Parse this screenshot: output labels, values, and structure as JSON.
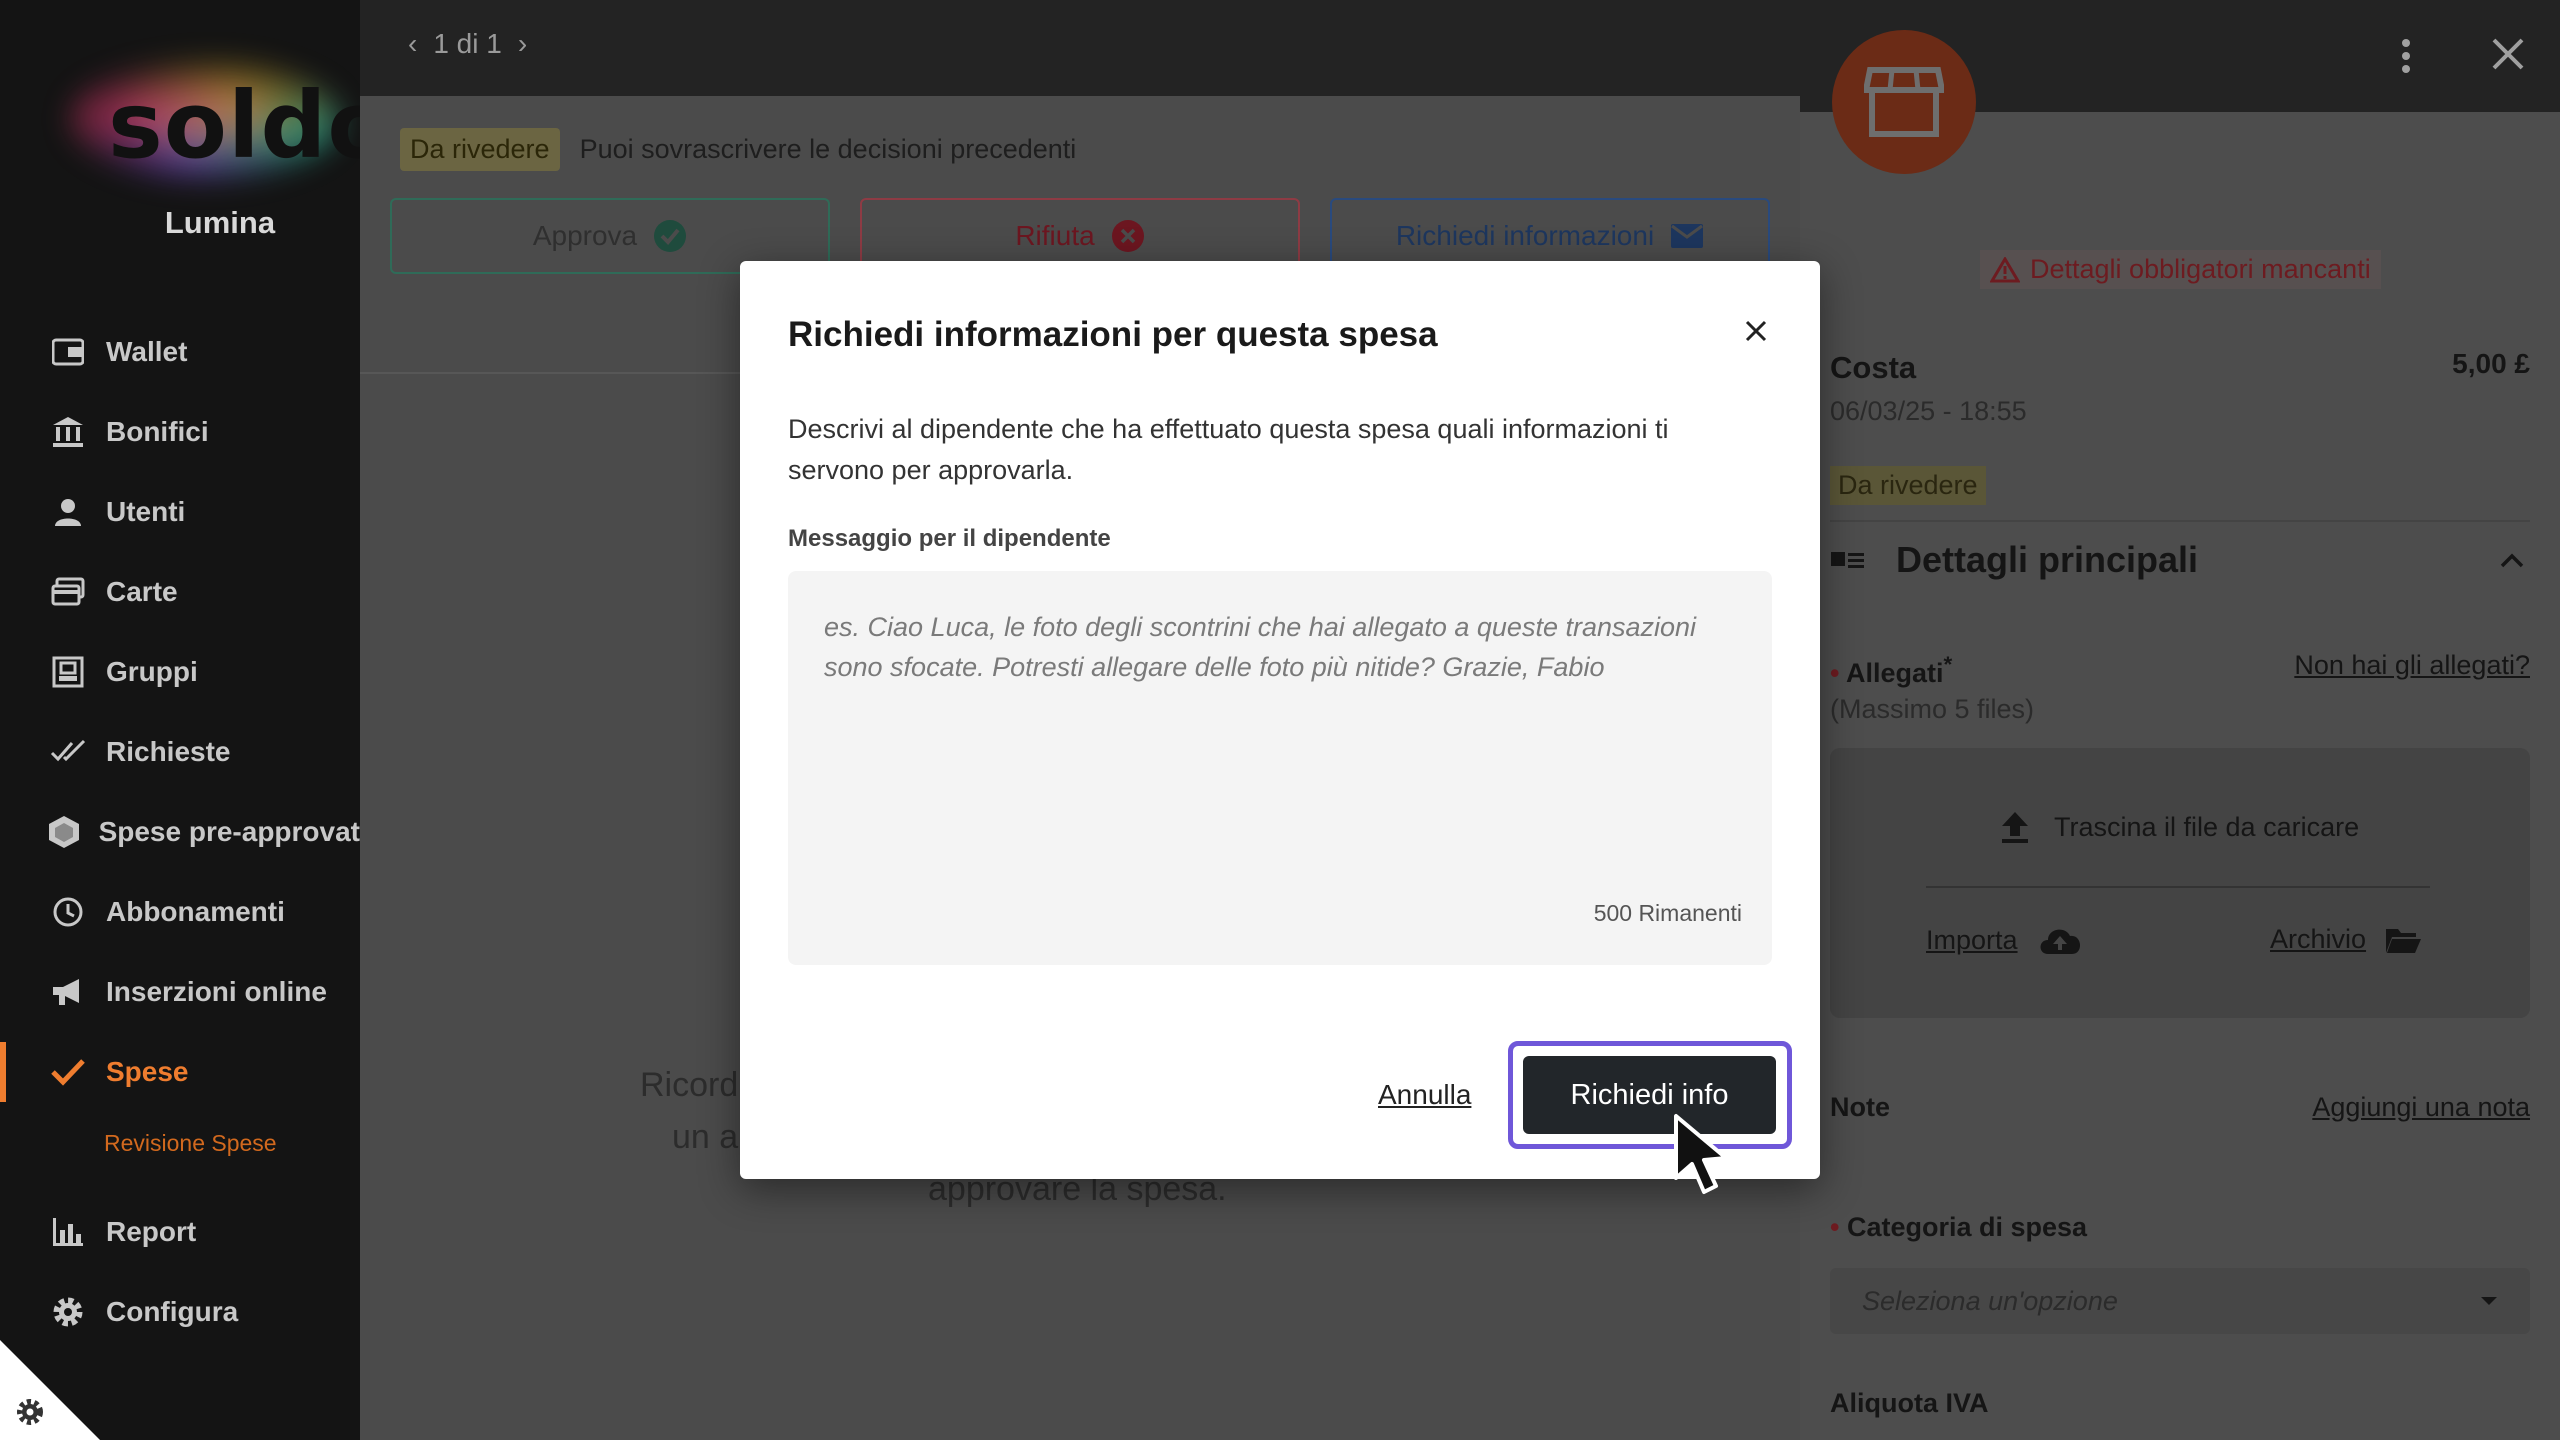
{
  "brand": {
    "logo_text": "soldo",
    "org_name": "Lumina"
  },
  "sidebar": {
    "items": [
      {
        "label": "Wallet",
        "icon": "wallet-icon"
      },
      {
        "label": "Bonifici",
        "icon": "bank-icon"
      },
      {
        "label": "Utenti",
        "icon": "user-icon"
      },
      {
        "label": "Carte",
        "icon": "cards-icon"
      },
      {
        "label": "Gruppi",
        "icon": "groups-icon"
      },
      {
        "label": "Richieste",
        "icon": "double-check-icon"
      },
      {
        "label": "Spese pre-approvat",
        "icon": "hexagon-icon"
      },
      {
        "label": "Abbonamenti",
        "icon": "clock-icon"
      },
      {
        "label": "Inserzioni online",
        "icon": "megaphone-icon"
      },
      {
        "label": "Spese",
        "icon": "check-icon",
        "active": true
      },
      {
        "label": "Report",
        "icon": "bar-chart-icon"
      },
      {
        "label": "Configura",
        "icon": "gear-icon"
      }
    ],
    "sub_item": "Revisione Spese"
  },
  "main": {
    "pager": "1 di 1",
    "status_tag": "Da rivedere",
    "notice": "Puoi sovrascrivere le decisioni precedenti",
    "actions": {
      "approve": "Approva",
      "reject": "Rifiuta",
      "request_info": "Richiedi informazioni"
    },
    "bg_text_line1_start": "Ricord",
    "bg_text_line2_start": "un a",
    "bg_text_line3": "approvare la spesa."
  },
  "panel": {
    "missing_details": "Dettagli obbligatori mancanti",
    "merchant": "Costa",
    "amount": "5,00 £",
    "datetime": "06/03/25 - 18:55",
    "status_tag": "Da rivedere",
    "section_title": "Dettagli principali",
    "attachments_label": "Allegati",
    "attachments_required_mark": "*",
    "attachments_hint": "(Massimo 5 files)",
    "no_attachments_link": "Non hai gli allegati?",
    "drag_text": "Trascina il file da caricare",
    "import_label": "Importa",
    "archive_label": "Archivio",
    "notes_label": "Note",
    "add_note_link": "Aggiungi una nota",
    "category_label": "Categoria di spesa",
    "category_placeholder": "Seleziona un'opzione",
    "vat_label": "Aliquota IVA"
  },
  "modal": {
    "title": "Richiedi informazioni per questa spesa",
    "description": "Descrivi al dipendente che ha effettuato questa spesa quali informazioni ti servono per approvarla.",
    "field_label": "Messaggio per il dipendente",
    "placeholder": "es. Ciao Luca, le foto degli scontrini che hai allegato a queste transazioni sono sfocate. Potresti allegare delle foto più nitide? Grazie, Fabio",
    "value": "",
    "counter": "500 Rimanenti",
    "cancel_label": "Annulla",
    "submit_label": "Richiedi info"
  },
  "colors": {
    "accent": "#ef7d2f",
    "focus_ring": "#6f57d9",
    "approve": "#2f6b58",
    "reject": "#8e3b44",
    "info": "#294a7e"
  }
}
